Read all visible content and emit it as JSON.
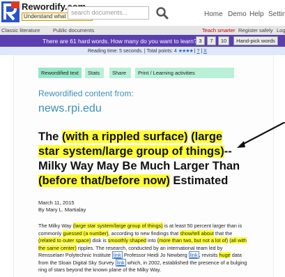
{
  "header": {
    "brand": "Rewordify.com",
    "tagline": "Understand what you read.",
    "search_placeholder": "search documents...",
    "nav": [
      "Home",
      "Demo",
      "Help",
      "Settings"
    ]
  },
  "subnav": {
    "left": [
      "Classic literature",
      "Public documents"
    ],
    "teach": "Teach smarter",
    "register": "Register safely",
    "login": "Log"
  },
  "hardwords": {
    "question": "There are 61 hard words. How many do you want to learn?",
    "options": [
      "3",
      "7",
      "10"
    ],
    "handpick_label": "Hand-pick words"
  },
  "reading": {
    "text": "Reading time: 5 seconds. | Total points: 4",
    "stars": "★★★★",
    "link1": "?",
    "link2": "X"
  },
  "tabs": [
    "Rewordified text",
    "Stats",
    "Share",
    "Print / Learning activities"
  ],
  "source": {
    "from_label": "Rewordified content from:",
    "domain": "news.rpi.edu"
  },
  "article": {
    "headline": {
      "p1": "The ",
      "h1": "(with a rippled surface)",
      "p2": " ",
      "h2": "(large star system/large group of things)",
      "p3": "--Milky Way May Be Much Larger Than ",
      "h3": "(before that/before now)",
      "p4": " Estimated"
    },
    "date": "March 11, 2015",
    "byline": "By Mary L. Martialay",
    "body": {
      "s1": "The Milky Way ",
      "h1": "(large star system/large group of things)",
      "s2": " is at least 50 percent larger than is commonly ",
      "h2": "guessed (a number)",
      "s3": ", according to new findings that ",
      "h3": "show/tell about",
      "s4": " that the ",
      "h4": "(related to outer space)",
      "s5": " disk is ",
      "h5": "smoothly shaped",
      "s6": " into ",
      "h6": "(more than two, but not a lot of)",
      "s7": " ",
      "h7": "(all with the same center)",
      "s8": " ripples. The research, conducted by an international team led by Rensselaer Polytechnic Institute ",
      "l1": "link",
      "s9": " Professor Heidi Jo Newberg ",
      "l2": "link",
      "s10": ", revisits ",
      "h8": "huge",
      "s11": " data from the Sloan Digital Sky Survey ",
      "l3": "link",
      "s12": " which, in 2002, established the presence of a bulging ring of stars beyond the known plane of the Milky Way."
    }
  },
  "colors": {
    "purple_bar": "#5b3fb0",
    "highlight": "#ffff33",
    "link_blue": "#3b8fbb",
    "tab_green": "#98e8c8"
  }
}
